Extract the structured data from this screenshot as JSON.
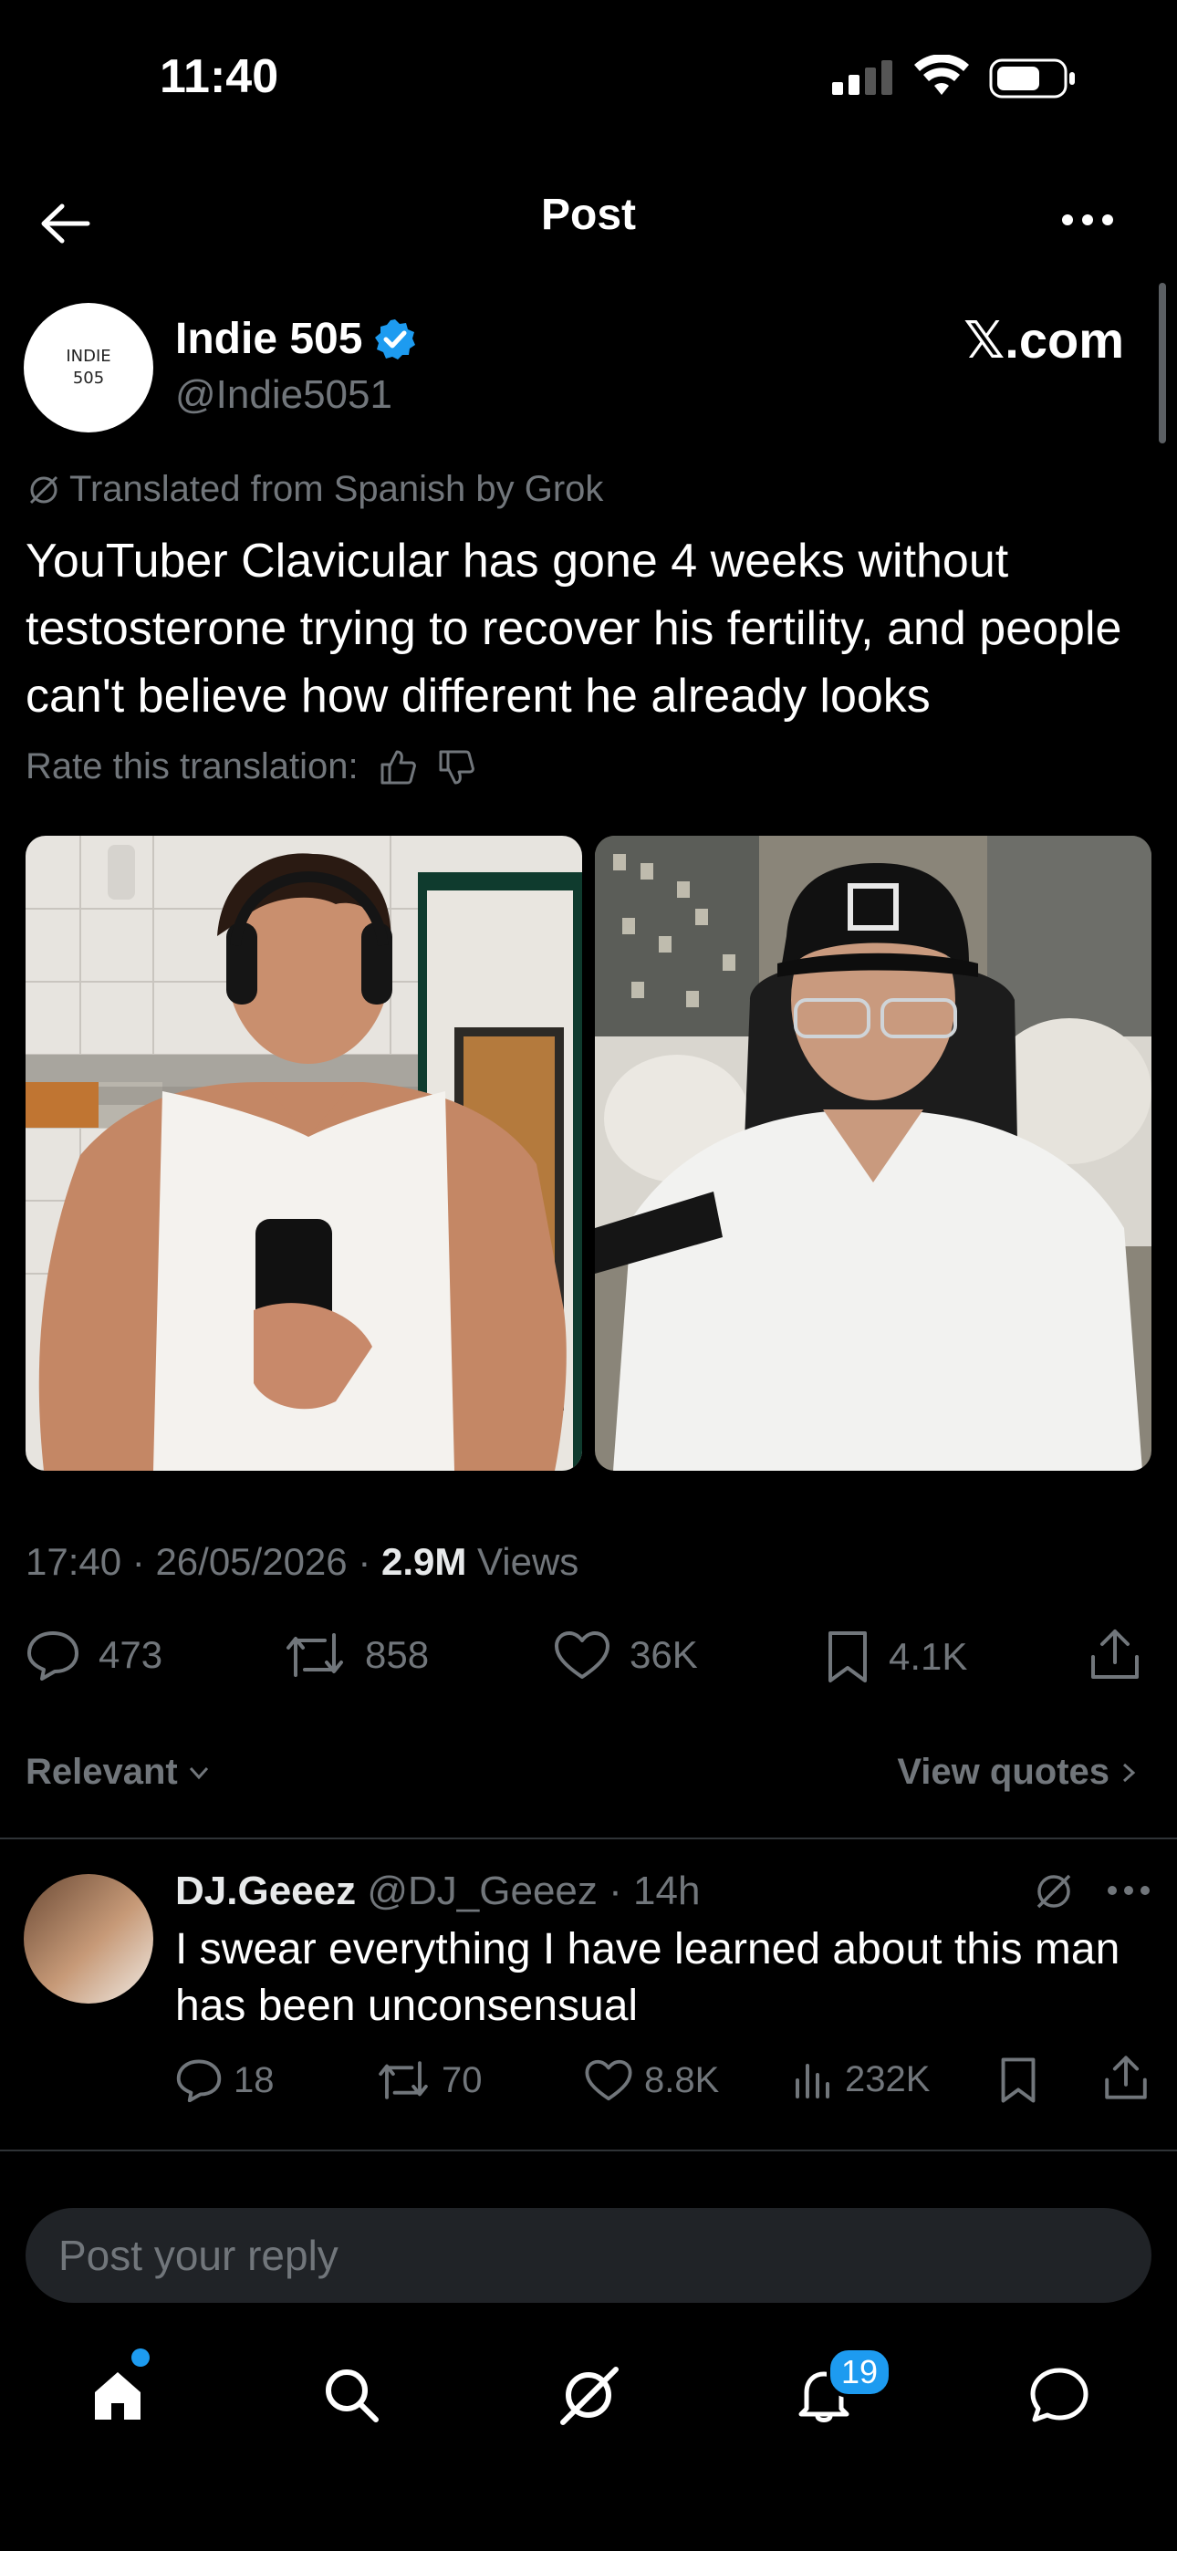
{
  "status_bar": {
    "time": "11:40"
  },
  "header": {
    "title": "Post"
  },
  "author": {
    "avatar_text_line1": "INDIE",
    "avatar_text_line2": "505",
    "name": "Indie 505",
    "handle": "@Indie5051",
    "source_badge": "𝕏.com"
  },
  "post": {
    "translation_note": "Translated from Spanish by Grok",
    "text": "YouTuber Clavicular has gone 4 weeks without testosterone trying to recover his fertility, and people can't believe how different he already looks",
    "rate_label": "Rate this translation:",
    "time": "17:40",
    "date": "26/05/2026",
    "views_count": "2.9M",
    "views_label": "Views",
    "replies": "473",
    "reposts": "858",
    "likes": "36K",
    "bookmarks": "4.1K"
  },
  "filters": {
    "sort_label": "Relevant",
    "view_quotes_label": "View quotes"
  },
  "reply": {
    "name": "DJ.Geeez",
    "handle": "@DJ_Geeez",
    "age": "14h",
    "text": "I swear everything I have learned about this man has been unconsensual",
    "replies": "18",
    "reposts": "70",
    "likes": "8.8K",
    "views": "232K"
  },
  "composer": {
    "placeholder": "Post your reply"
  },
  "bottom_nav": {
    "notifications_badge": "19"
  },
  "colors": {
    "accent": "#1d9bf0",
    "background": "#000000",
    "muted": "#71767b"
  }
}
